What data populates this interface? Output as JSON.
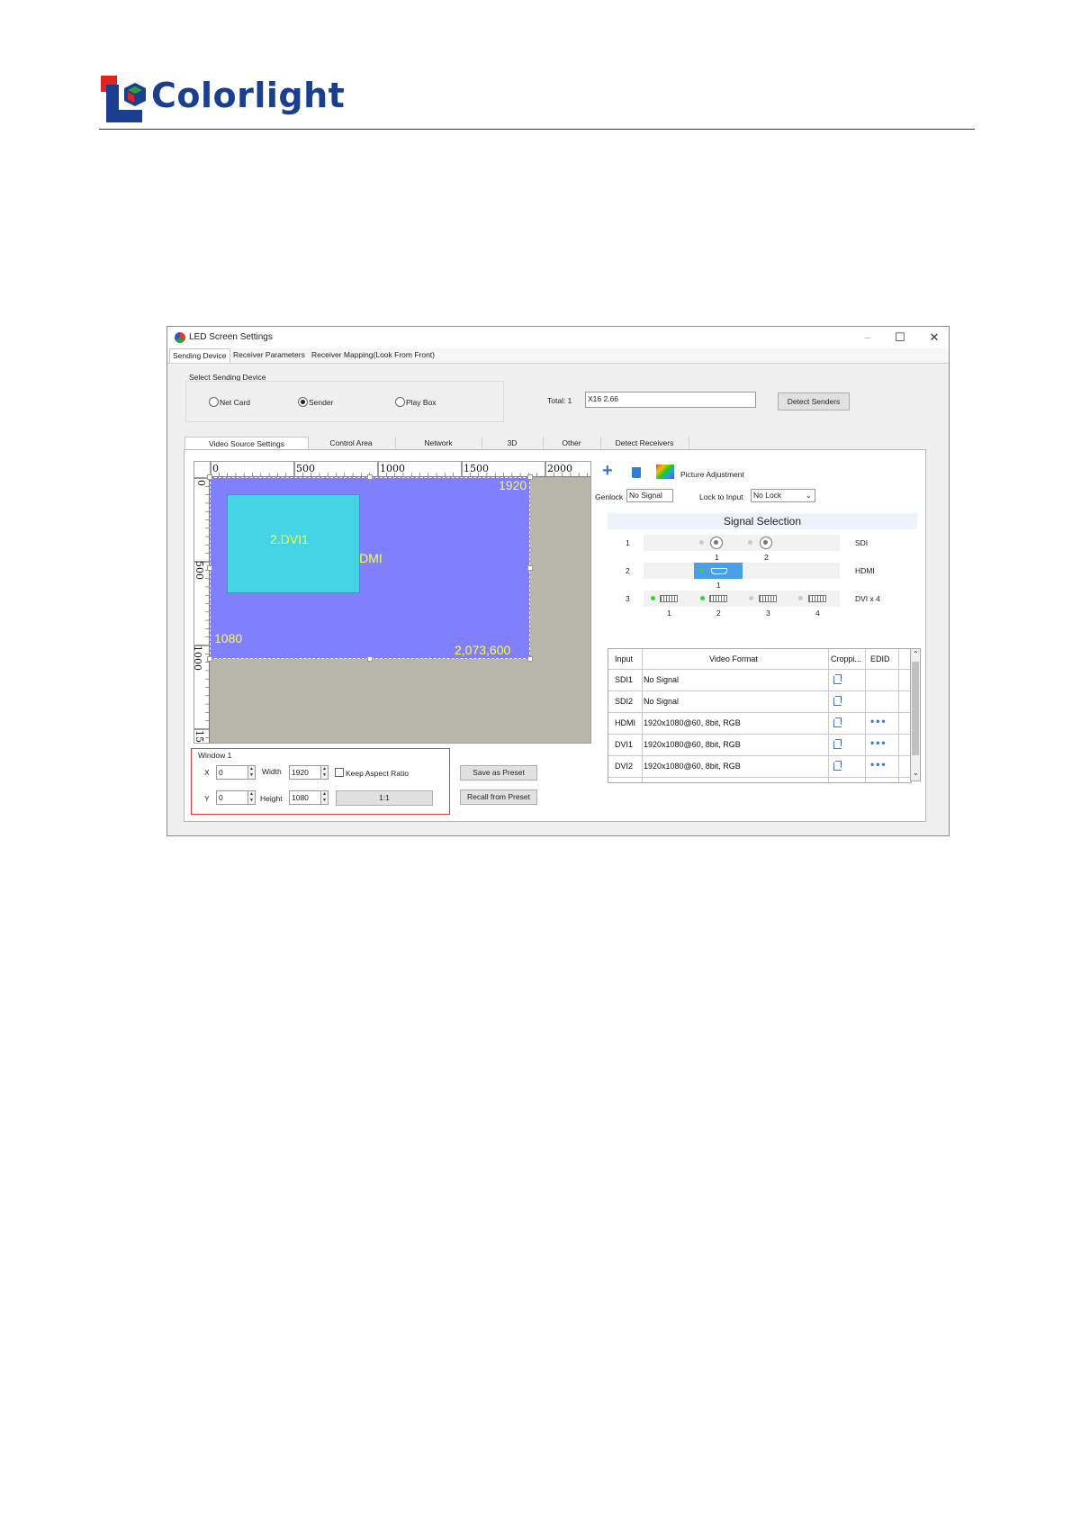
{
  "logo": {
    "text": "Colorlight",
    "colors": {
      "red": "#e2231a",
      "blue": "#1a3f8f",
      "green": "#2a9f3b"
    }
  },
  "window": {
    "title": "LED Screen Settings",
    "controls": [
      "minimize",
      "maximize",
      "close"
    ],
    "tabs": [
      "Sending Device",
      "Receiver Parameters",
      "Receiver Mapping(Look From Front)"
    ],
    "active_tab": "Sending Device"
  },
  "sending_device": {
    "group_label": "Select Sending Device",
    "options": [
      "Net Card",
      "Sender",
      "Play Box"
    ],
    "selected": "Sender",
    "total_label": "Total:  1",
    "device_value": "X16 2.66",
    "detect_senders_label": "Detect Senders"
  },
  "sub_tabs": [
    "Video Source Settings",
    "Control Area",
    "Network",
    "3D",
    "Other",
    "Detect Receivers"
  ],
  "canvas": {
    "ruler_h": [
      "0",
      "500",
      "1000",
      "1500",
      "2000"
    ],
    "ruler_v": [
      "0",
      "500",
      "1000",
      "15"
    ],
    "hdmi_label": "HDMI",
    "dvi_label": "2.DVI1",
    "width_label": "1920",
    "height_label": "1080",
    "pixels_label": "2,073,600",
    "canvas_bg": "#b8b6aa",
    "hdmi_color": "#8080ff",
    "dvi_color": "#44d4e6"
  },
  "window1": {
    "title": "Window 1",
    "x_label": "X",
    "x_value": "0",
    "y_label": "Y",
    "y_value": "0",
    "width_label": "Width",
    "width_value": "1920",
    "height_label": "Height",
    "height_value": "1080",
    "keep_aspect_label": "Keep Aspect Ratio",
    "ratio_label": "1:1",
    "save_preset_label": "Save as Preset",
    "recall_preset_label": "Recall from Preset"
  },
  "toolbar": {
    "add_icon": "plus-icon",
    "delete_icon": "trash-icon",
    "picture_adjustment_label": "Picture Adjustment",
    "genlock_label": "Genlock",
    "genlock_value": "No Signal",
    "lock_to_input_label": "Lock to Input",
    "lock_to_input_value": "No Lock"
  },
  "signal_selection": {
    "title": "Signal Selection",
    "rows": [
      {
        "index": "1",
        "type": "SDI",
        "ports": [
          "1",
          "2"
        ]
      },
      {
        "index": "2",
        "type": "HDMI",
        "ports": [
          "1"
        ]
      },
      {
        "index": "3",
        "type": "DVI x 4",
        "ports": [
          "1",
          "2",
          "3",
          "4"
        ]
      }
    ],
    "selected_color": "#4aa0e6"
  },
  "inputs_table": {
    "headers": [
      "Input",
      "Video Format",
      "Croppi...",
      "EDID"
    ],
    "rows": [
      {
        "input": "SDI1",
        "format": "No Signal",
        "edid": ""
      },
      {
        "input": "SDI2",
        "format": "No Signal",
        "edid": ""
      },
      {
        "input": "HDMI",
        "format": "1920x1080@60, 8bit, RGB",
        "edid": "•••"
      },
      {
        "input": "DVI1",
        "format": "1920x1080@60, 8bit, RGB",
        "edid": "•••"
      },
      {
        "input": "DVI2",
        "format": "1920x1080@60, 8bit, RGB",
        "edid": "•••"
      }
    ]
  }
}
